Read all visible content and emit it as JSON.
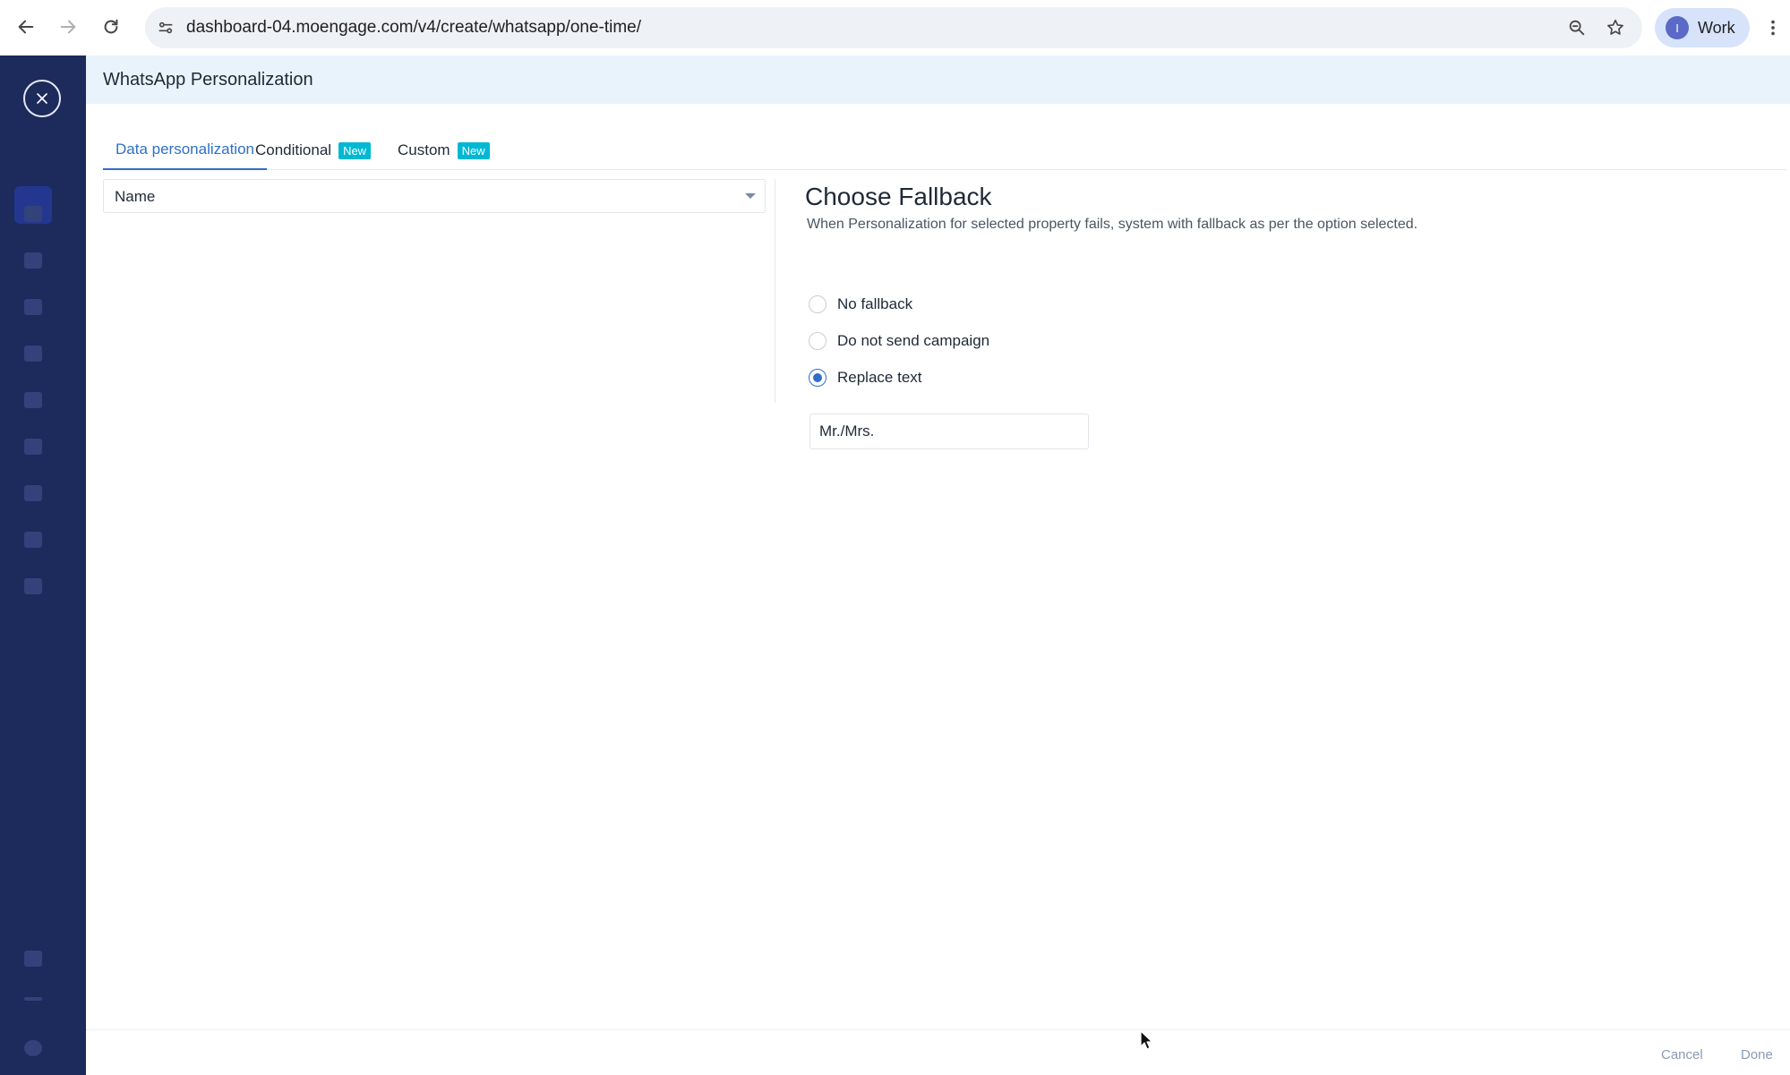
{
  "browser": {
    "url": "dashboard-04.moengage.com/v4/create/whatsapp/one-time/",
    "profile_initial": "I",
    "profile_label": "Work"
  },
  "modal": {
    "title": "WhatsApp Personalization",
    "tabs": [
      {
        "label": "Data personalization",
        "badge": ""
      },
      {
        "label": "Conditional",
        "badge": "New"
      },
      {
        "label": "Custom",
        "badge": "New"
      }
    ],
    "property_select_value": "Name",
    "fallback": {
      "title": "Choose Fallback",
      "description": "When Personalization for selected property fails, system with fallback as per the option selected.",
      "options": [
        {
          "label": "No fallback",
          "checked": false
        },
        {
          "label": "Do not send campaign",
          "checked": false
        },
        {
          "label": "Replace text",
          "checked": true
        }
      ],
      "replace_text_value": "Mr./Mrs."
    },
    "footer": {
      "cancel_label": "Cancel",
      "done_label": "Done"
    }
  },
  "colors": {
    "accent": "#2f6fc8",
    "badge": "#00b8d4",
    "header_bg": "#e8f3fc",
    "sidebar_bg": "#1c2a5c"
  }
}
